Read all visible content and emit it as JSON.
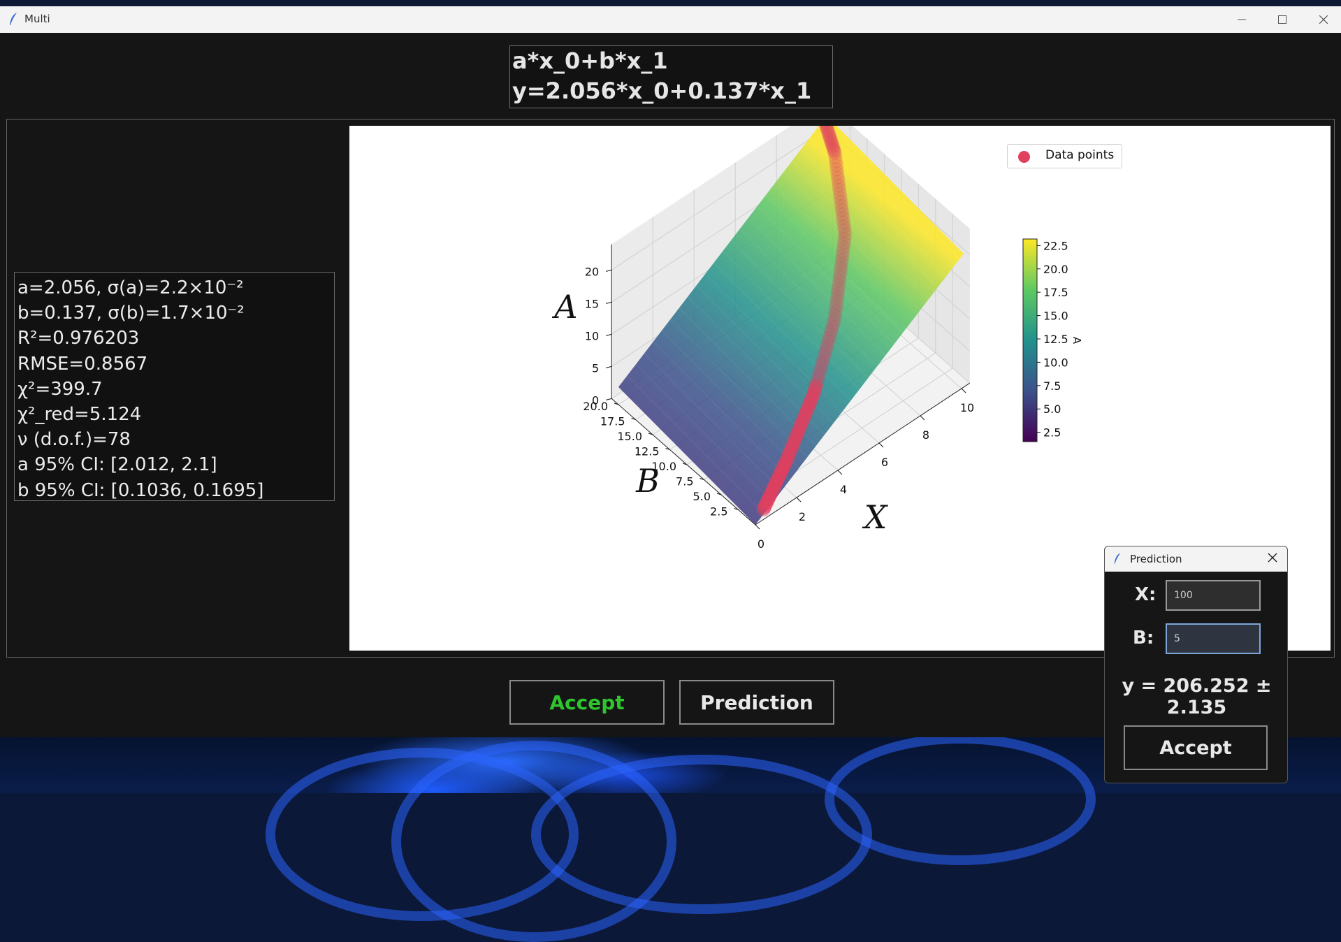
{
  "window": {
    "title": "Multi"
  },
  "formula": {
    "line1": "a*x_0+b*x_1",
    "line2": "y=2.056*x_0+0.137*x_1"
  },
  "stats": [
    "a=2.056, σ(a)=2.2×10⁻²",
    "b=0.137, σ(b)=1.7×10⁻²",
    "R²=0.976203",
    "RMSE=0.8567",
    "χ²=399.7",
    "χ²_red=5.124",
    "ν (d.o.f.)=78",
    "a 95% CI: [2.012, 2.1]",
    "b 95% CI: [0.1036, 0.1695]"
  ],
  "chart_data": {
    "type": "surface3d",
    "legend": {
      "label": "Data points",
      "placement": "top-right"
    },
    "axes": {
      "x": {
        "label": "X",
        "ticks": [
          "0",
          "2",
          "4",
          "6",
          "8",
          "10"
        ],
        "range": [
          0,
          10
        ]
      },
      "y": {
        "label": "B",
        "ticks": [
          "2.5",
          "5.0",
          "7.5",
          "10.0",
          "12.5",
          "15.0",
          "17.5",
          "20.0"
        ],
        "range": [
          0,
          21
        ]
      },
      "z": {
        "label": "A",
        "ticks": [
          "0",
          "5",
          "10",
          "15",
          "20"
        ],
        "range": [
          0,
          24
        ]
      }
    },
    "colorbar": {
      "label": "A",
      "ticks": [
        "2.5",
        "5.0",
        "7.5",
        "10.0",
        "12.5",
        "15.0",
        "17.5",
        "20.0",
        "22.5"
      ],
      "range": [
        1.5,
        23.2
      ],
      "colormap": "viridis"
    },
    "surface": {
      "equation": "A = 2.056*X + 0.137*B"
    },
    "points_color": "#e0405e",
    "points_sample": [
      {
        "x": 0.5,
        "b": 0.3,
        "a": 1.1
      },
      {
        "x": 2.0,
        "b": 1.5,
        "a": 4.3
      },
      {
        "x": 4.0,
        "b": 3.5,
        "a": 8.7
      },
      {
        "x": 6.0,
        "b": 6.5,
        "a": 13.2
      },
      {
        "x": 8.0,
        "b": 11.0,
        "a": 17.9
      },
      {
        "x": 9.5,
        "b": 17.0,
        "a": 21.8
      },
      {
        "x": 10.0,
        "b": 20.0,
        "a": 23.0
      }
    ]
  },
  "buttons": {
    "accept": "Accept",
    "prediction": "Prediction"
  },
  "colors": {
    "accept_text": "#2fc52f",
    "button_text": "#e8e8e8",
    "background": "#151515"
  },
  "prediction_dialog": {
    "title": "Prediction",
    "x_label": "X:",
    "x_value": "100",
    "b_label": "B:",
    "b_value": "5",
    "result": "y = 206.252 ± 2.135",
    "accept_label": "Accept"
  }
}
